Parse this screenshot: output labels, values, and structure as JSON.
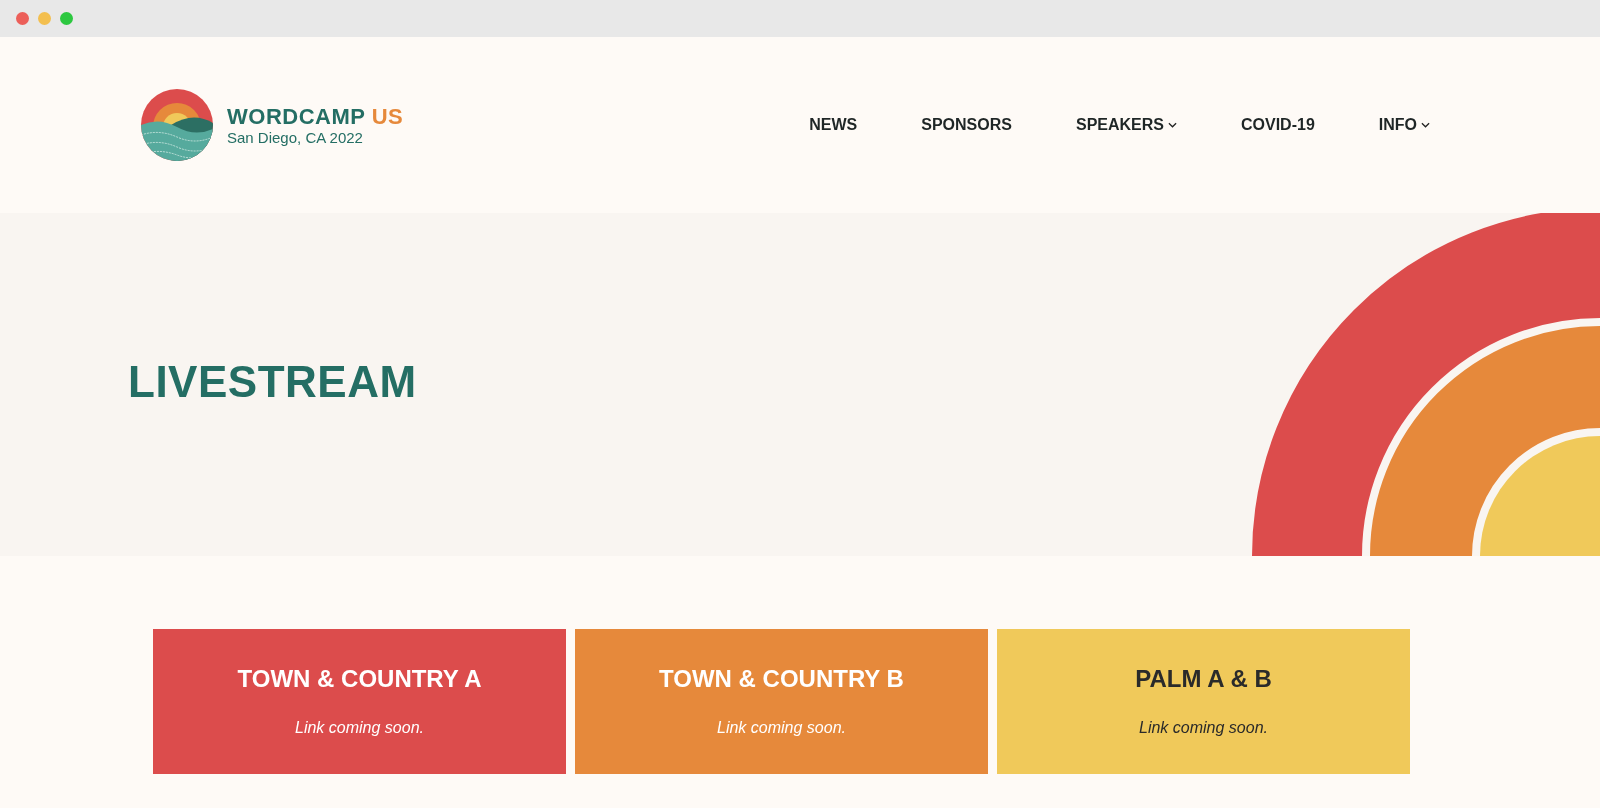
{
  "brand": {
    "name": "WORDCAMP",
    "suffix": "US",
    "tagline": "San Diego, CA 2022"
  },
  "nav": [
    {
      "label": "NEWS",
      "kind": "link"
    },
    {
      "label": "SPONSORS",
      "kind": "link"
    },
    {
      "label": "SPEAKERS",
      "kind": "dropdown"
    },
    {
      "label": "COVID-19",
      "kind": "link"
    },
    {
      "label": "INFO",
      "kind": "dropdown"
    }
  ],
  "hero": {
    "title": "LIVESTREAM"
  },
  "rooms": [
    {
      "name": "TOWN & COUNTRY A",
      "note": "Link coming soon.",
      "color": "#dc4c4c"
    },
    {
      "name": "TOWN & COUNTRY B",
      "note": "Link coming soon.",
      "color": "#e6893b"
    },
    {
      "name": "PALM A & B",
      "note": "Link coming soon.",
      "color": "#f0c95a"
    }
  ]
}
